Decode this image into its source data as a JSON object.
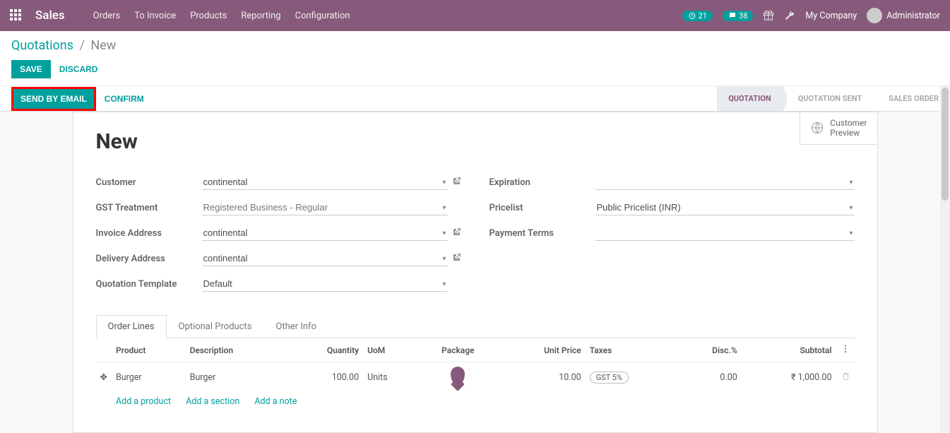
{
  "colors": {
    "brand": "#875A7B",
    "accent": "#00A09D"
  },
  "navbar": {
    "brand": "Sales",
    "menu": [
      "Orders",
      "To Invoice",
      "Products",
      "Reporting",
      "Configuration"
    ],
    "timer_badge": "21",
    "chat_badge": "38",
    "company": "My Company",
    "user": "Administrator",
    "icons": {
      "apps": "apps-icon",
      "timer": "timer-icon",
      "chat": "chat-icon",
      "gift": "gift-icon",
      "wrench": "wrench-icon"
    }
  },
  "breadcrumb": {
    "root": "Quotations",
    "current": "New"
  },
  "cp": {
    "save": "SAVE",
    "discard": "DISCARD"
  },
  "statusbar": {
    "send_email": "SEND BY EMAIL",
    "confirm": "CONFIRM",
    "steps": [
      "QUOTATION",
      "QUOTATION SENT",
      "SALES ORDER"
    ]
  },
  "button_box": {
    "preview": "Customer\nPreview"
  },
  "record": {
    "title": "New"
  },
  "fields_left": {
    "customer_label": "Customer",
    "customer": "continental",
    "gst_label": "GST Treatment",
    "gst": "Registered Business - Regular",
    "invoice_addr_label": "Invoice Address",
    "invoice_addr": "continental",
    "delivery_addr_label": "Delivery Address",
    "delivery_addr": "continental",
    "template_label": "Quotation Template",
    "template": "Default"
  },
  "fields_right": {
    "expiration_label": "Expiration",
    "expiration": "",
    "pricelist_label": "Pricelist",
    "pricelist": "Public Pricelist (INR)",
    "payment_terms_label": "Payment Terms",
    "payment_terms": ""
  },
  "tabs": {
    "t1": "Order Lines",
    "t2": "Optional Products",
    "t3": "Other Info"
  },
  "ol_headers": {
    "product": "Product",
    "description": "Description",
    "qty": "Quantity",
    "uom": "UoM",
    "package": "Package",
    "unit_price": "Unit Price",
    "taxes": "Taxes",
    "disc": "Disc.%",
    "subtotal": "Subtotal"
  },
  "ol_row": {
    "product": "Burger",
    "description": "Burger",
    "qty": "100.00",
    "uom": "Units",
    "unit_price": "10.00",
    "taxes": "GST 5%",
    "disc": "0.00",
    "subtotal": "₹ 1,000.00"
  },
  "add_links": {
    "product": "Add a product",
    "section": "Add a section",
    "note": "Add a note"
  }
}
